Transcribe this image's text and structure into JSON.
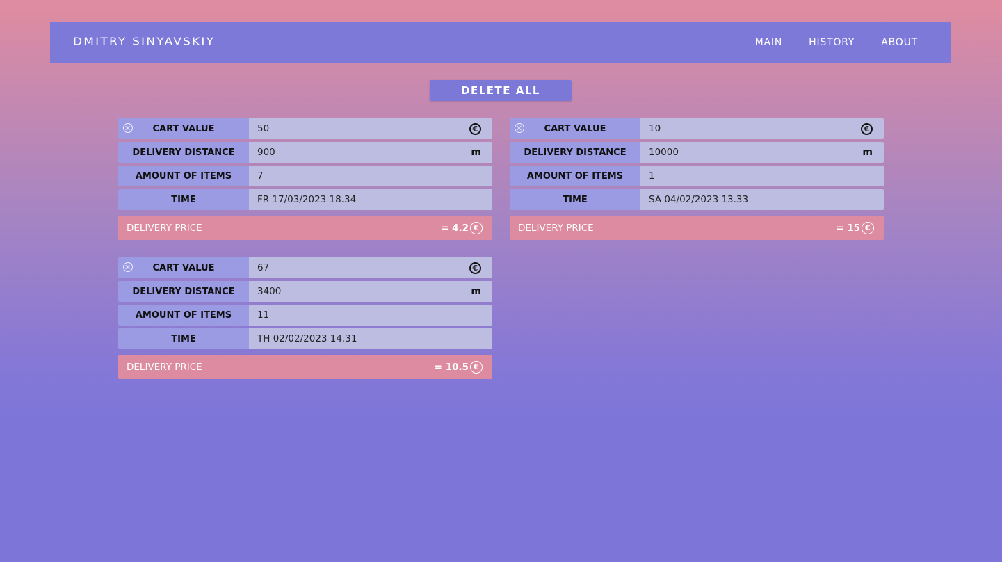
{
  "header": {
    "brand": "DMITRY SINYAVSKIY",
    "nav": [
      "MAIN",
      "HISTORY",
      "ABOUT"
    ]
  },
  "actions": {
    "delete_all": "DELETE ALL"
  },
  "labels": {
    "cart_value": "CART VALUE",
    "delivery_distance": "DELIVERY DISTANCE",
    "amount_of_items": "AMOUNT OF ITEMS",
    "time": "TIME",
    "delivery_price": "DELIVERY PRICE",
    "distance_unit": "m",
    "currency_symbol": "€"
  },
  "entries": [
    {
      "cart_value": "50",
      "distance": "900",
      "items": "7",
      "time": "FR 17/03/2023 18.34",
      "price": "= 4.2"
    },
    {
      "cart_value": "10",
      "distance": "10000",
      "items": "1",
      "time": "SA 04/02/2023 13.33",
      "price": "= 15"
    },
    {
      "cart_value": "67",
      "distance": "3400",
      "items": "11",
      "time": "TH 02/02/2023 14.31",
      "price": "= 10.5"
    }
  ],
  "colors": {
    "header_bg": "#7d79d8",
    "label_bg": "#9a9be2",
    "value_bg": "#bdbde2",
    "price_bg": "#dd8ba0"
  }
}
